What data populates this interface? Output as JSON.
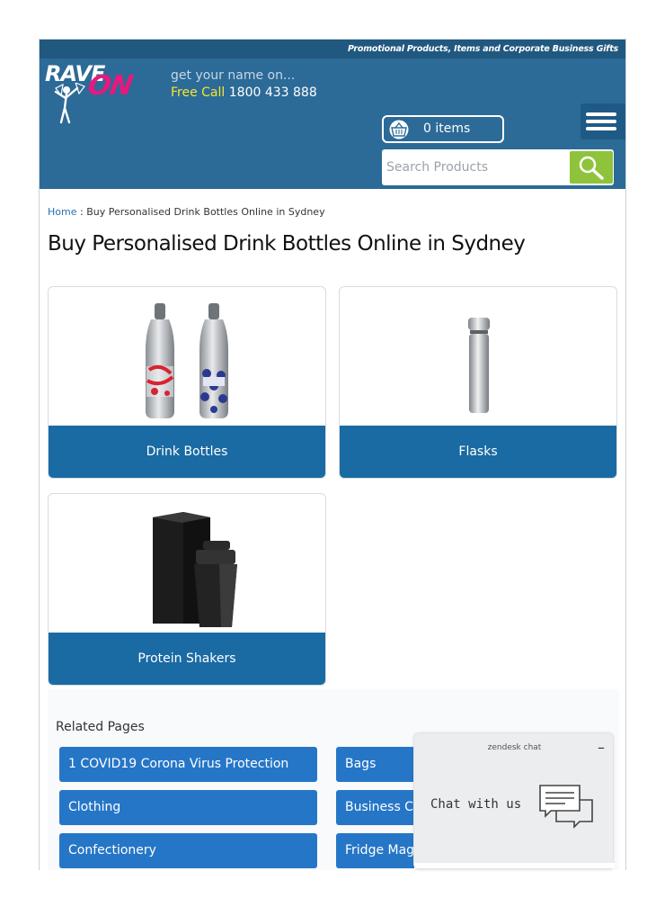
{
  "header": {
    "tagline": "Promotional Products, Items and Corporate Business Gifts",
    "logo_line1": "RAVE",
    "logo_line2": "ON",
    "slogan": "get your name on...",
    "free_call_label": "Free Call",
    "phone": "1800 433 888",
    "cart_label": "0 items",
    "search_placeholder": "Search Products"
  },
  "breadcrumb": {
    "home": "Home",
    "separator": " : ",
    "current": "Buy Personalised Drink Bottles Online in Sydney"
  },
  "page": {
    "title": "Buy Personalised Drink Bottles Online in Sydney"
  },
  "categories": [
    {
      "label": "Drink Bottles",
      "image": "drink-bottles-image"
    },
    {
      "label": "Flasks",
      "image": "flask-image"
    },
    {
      "label": "Protein Shakers",
      "image": "protein-shaker-image"
    }
  ],
  "related": {
    "title": "Related Pages",
    "links": [
      "1 COVID19 Corona Virus Protection",
      "Bags",
      "Clothing",
      "Business Ca",
      "Confectionery",
      "Fridge Magr"
    ]
  },
  "chat": {
    "header": "zendesk chat",
    "minimize": "–",
    "prompt": "Chat with us"
  },
  "colors": {
    "header_bg": "#2c6a97",
    "topbar_bg": "#21587f",
    "accent_yellow": "#f6e630",
    "logo_pink": "#e8187f",
    "category_bar": "#1a6aa3",
    "related_button": "#2676c7",
    "search_button": "#8fc33b",
    "link": "#2a6fb1"
  }
}
